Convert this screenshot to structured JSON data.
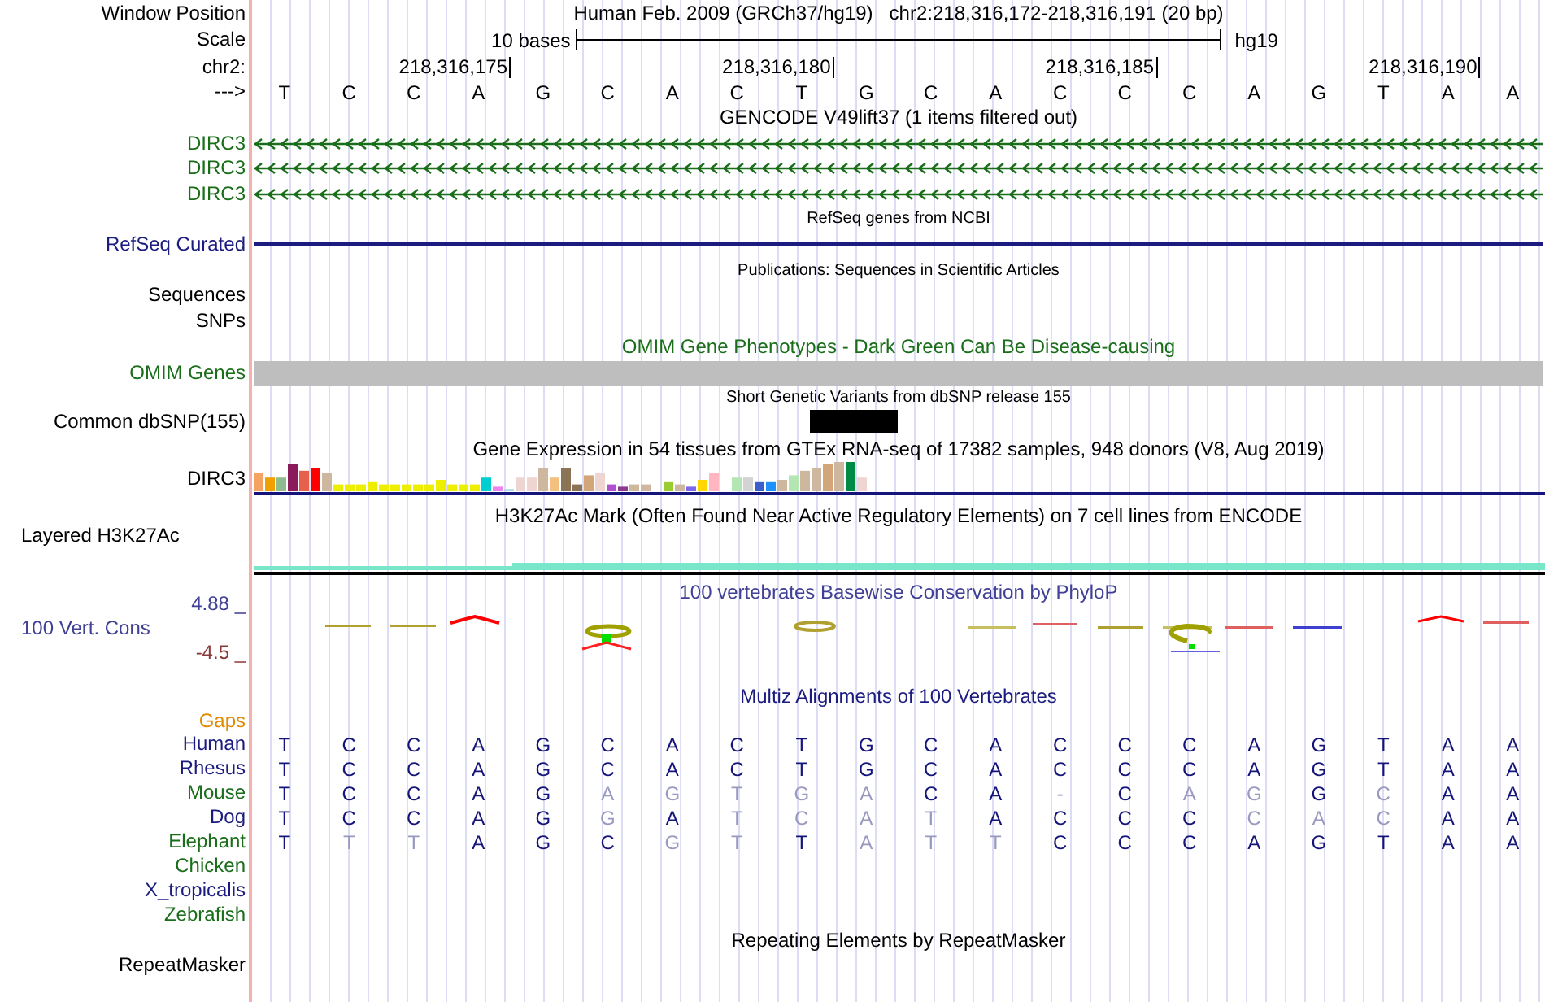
{
  "header": {
    "label": "Window Position",
    "title": "Human Feb. 2009 (GRCh37/hg19)",
    "position": "chr2:218,316,172-218,316,191 (20 bp)"
  },
  "scale": {
    "label": "Scale",
    "span": "10 bases",
    "assembly": "hg19"
  },
  "coordinates": {
    "label": "chr2:",
    "ticks": [
      "218,316,175",
      "218,316,180",
      "218,316,185",
      "218,316,190"
    ]
  },
  "sequence": {
    "label": "--->",
    "bases": [
      "T",
      "C",
      "C",
      "A",
      "G",
      "C",
      "A",
      "C",
      "T",
      "G",
      "C",
      "A",
      "C",
      "C",
      "C",
      "A",
      "G",
      "T",
      "A",
      "A"
    ]
  },
  "tracks": [
    {
      "kind": "gene_arrows",
      "title": "GENCODE V49lift37 (1 items filtered out)",
      "color": "#1a6e1a",
      "labels": [
        "DIRC3",
        "DIRC3",
        "DIRC3"
      ]
    },
    {
      "kind": "gene_line",
      "title": "RefSeq genes from NCBI",
      "color": "#1c1c80",
      "labels": [
        "RefSeq Curated"
      ]
    },
    {
      "kind": "empty",
      "title": "Publications: Sequences in Scientific Articles",
      "color": "#000000",
      "labels": [
        "Sequences",
        "SNPs"
      ]
    },
    {
      "kind": "gray_bar",
      "title": "OMIM Gene Phenotypes - Dark Green Can Be Disease-causing",
      "color": "#1a6e1a",
      "labels": [
        "OMIM Genes"
      ]
    },
    {
      "kind": "variant",
      "title": "Short Genetic Variants from dbSNP release 155",
      "color": "#000000",
      "labels": [
        "Common dbSNP(155)"
      ]
    },
    {
      "kind": "expression",
      "title": "Gene Expression in 54 tissues from GTEx RNA-seq of 17382 samples, 948 donors (V8, Aug 2019)",
      "color": "#000000",
      "labels": [
        "DIRC3"
      ]
    },
    {
      "kind": "signal",
      "title": "H3K27Ac Mark (Often Found Near Active Regulatory Elements) on 7 cell lines from ENCODE",
      "color": "#000000",
      "labels": [
        "Layered H3K27Ac"
      ]
    },
    {
      "kind": "conservation",
      "title": "100 vertebrates Basewise Conservation by PhyloP",
      "color": "#404096",
      "labels": [
        "100 Vert. Cons"
      ],
      "max": "4.88 _",
      "min": "-4.5 _"
    },
    {
      "kind": "alignment",
      "title": "Multiz Alignments of 100 Vertebrates",
      "color": "#1c1c80",
      "labels": [
        "Gaps"
      ],
      "species": [
        {
          "name": "Human",
          "color": "#1c1c80",
          "bases": [
            {
              "base": "T",
              "matches": true
            },
            {
              "base": "C",
              "matches": true
            },
            {
              "base": "C",
              "matches": true
            },
            {
              "base": "A",
              "matches": true
            },
            {
              "base": "G",
              "matches": true
            },
            {
              "base": "C",
              "matches": true
            },
            {
              "base": "A",
              "matches": true
            },
            {
              "base": "C",
              "matches": true
            },
            {
              "base": "T",
              "matches": true
            },
            {
              "base": "G",
              "matches": true
            },
            {
              "base": "C",
              "matches": true
            },
            {
              "base": "A",
              "matches": true
            },
            {
              "base": "C",
              "matches": true
            },
            {
              "base": "C",
              "matches": true
            },
            {
              "base": "C",
              "matches": true
            },
            {
              "base": "A",
              "matches": true
            },
            {
              "base": "G",
              "matches": true
            },
            {
              "base": "T",
              "matches": true
            },
            {
              "base": "A",
              "matches": true
            },
            {
              "base": "A",
              "matches": true
            }
          ]
        },
        {
          "name": "Rhesus",
          "color": "#1c1c80",
          "bases": [
            {
              "base": "T",
              "matches": true
            },
            {
              "base": "C",
              "matches": true
            },
            {
              "base": "C",
              "matches": true
            },
            {
              "base": "A",
              "matches": true
            },
            {
              "base": "G",
              "matches": true
            },
            {
              "base": "C",
              "matches": true
            },
            {
              "base": "A",
              "matches": true
            },
            {
              "base": "C",
              "matches": true
            },
            {
              "base": "T",
              "matches": true
            },
            {
              "base": "G",
              "matches": true
            },
            {
              "base": "C",
              "matches": true
            },
            {
              "base": "A",
              "matches": true
            },
            {
              "base": "C",
              "matches": true
            },
            {
              "base": "C",
              "matches": true
            },
            {
              "base": "C",
              "matches": true
            },
            {
              "base": "A",
              "matches": true
            },
            {
              "base": "G",
              "matches": true
            },
            {
              "base": "T",
              "matches": true
            },
            {
              "base": "A",
              "matches": true
            },
            {
              "base": "A",
              "matches": true
            }
          ]
        },
        {
          "name": "Mouse",
          "color": "#1a6e1a",
          "bases": [
            {
              "base": "T",
              "matches": true
            },
            {
              "base": "C",
              "matches": true
            },
            {
              "base": "C",
              "matches": true
            },
            {
              "base": "A",
              "matches": true
            },
            {
              "base": "G",
              "matches": true
            },
            {
              "base": "A",
              "matches": false
            },
            {
              "base": "G",
              "matches": false
            },
            {
              "base": "T",
              "matches": false
            },
            {
              "base": "G",
              "matches": false
            },
            {
              "base": "A",
              "matches": false
            },
            {
              "base": "C",
              "matches": true
            },
            {
              "base": "A",
              "matches": true
            },
            {
              "base": "-",
              "matches": false
            },
            {
              "base": "C",
              "matches": true
            },
            {
              "base": "A",
              "matches": false
            },
            {
              "base": "G",
              "matches": false
            },
            {
              "base": "G",
              "matches": true
            },
            {
              "base": "C",
              "matches": false
            },
            {
              "base": "A",
              "matches": true
            },
            {
              "base": "A",
              "matches": true
            }
          ]
        },
        {
          "name": "Dog",
          "color": "#1c1c80",
          "bases": [
            {
              "base": "T",
              "matches": true
            },
            {
              "base": "C",
              "matches": true
            },
            {
              "base": "C",
              "matches": true
            },
            {
              "base": "A",
              "matches": true
            },
            {
              "base": "G",
              "matches": true
            },
            {
              "base": "G",
              "matches": false
            },
            {
              "base": "A",
              "matches": true
            },
            {
              "base": "T",
              "matches": false
            },
            {
              "base": "C",
              "matches": false
            },
            {
              "base": "A",
              "matches": false
            },
            {
              "base": "T",
              "matches": false
            },
            {
              "base": "A",
              "matches": true
            },
            {
              "base": "C",
              "matches": true
            },
            {
              "base": "C",
              "matches": true
            },
            {
              "base": "C",
              "matches": true
            },
            {
              "base": "C",
              "matches": false
            },
            {
              "base": "A",
              "matches": false
            },
            {
              "base": "C",
              "matches": false
            },
            {
              "base": "A",
              "matches": true
            },
            {
              "base": "A",
              "matches": true
            }
          ]
        },
        {
          "name": "Elephant",
          "color": "#1a6e1a",
          "bases": [
            {
              "base": "T",
              "matches": true
            },
            {
              "base": "T",
              "matches": false
            },
            {
              "base": "T",
              "matches": false
            },
            {
              "base": "A",
              "matches": true
            },
            {
              "base": "G",
              "matches": true
            },
            {
              "base": "C",
              "matches": true
            },
            {
              "base": "G",
              "matches": false
            },
            {
              "base": "T",
              "matches": false
            },
            {
              "base": "T",
              "matches": true
            },
            {
              "base": "A",
              "matches": false
            },
            {
              "base": "T",
              "matches": false
            },
            {
              "base": "T",
              "matches": false
            },
            {
              "base": "C",
              "matches": true
            },
            {
              "base": "C",
              "matches": true
            },
            {
              "base": "C",
              "matches": true
            },
            {
              "base": "A",
              "matches": true
            },
            {
              "base": "G",
              "matches": true
            },
            {
              "base": "T",
              "matches": true
            },
            {
              "base": "A",
              "matches": true
            },
            {
              "base": "A",
              "matches": true
            }
          ]
        },
        {
          "name": "Chicken",
          "color": "#1a6e1a"
        },
        {
          "name": "X_tropicalis",
          "color": "#1c1c80"
        },
        {
          "name": "Zebrafish",
          "color": "#1a6e1a"
        }
      ]
    },
    {
      "kind": "repeats",
      "title": "Repeating Elements by RepeatMasker",
      "color": "#000000",
      "labels": [
        "RepeatMasker"
      ]
    }
  ]
}
